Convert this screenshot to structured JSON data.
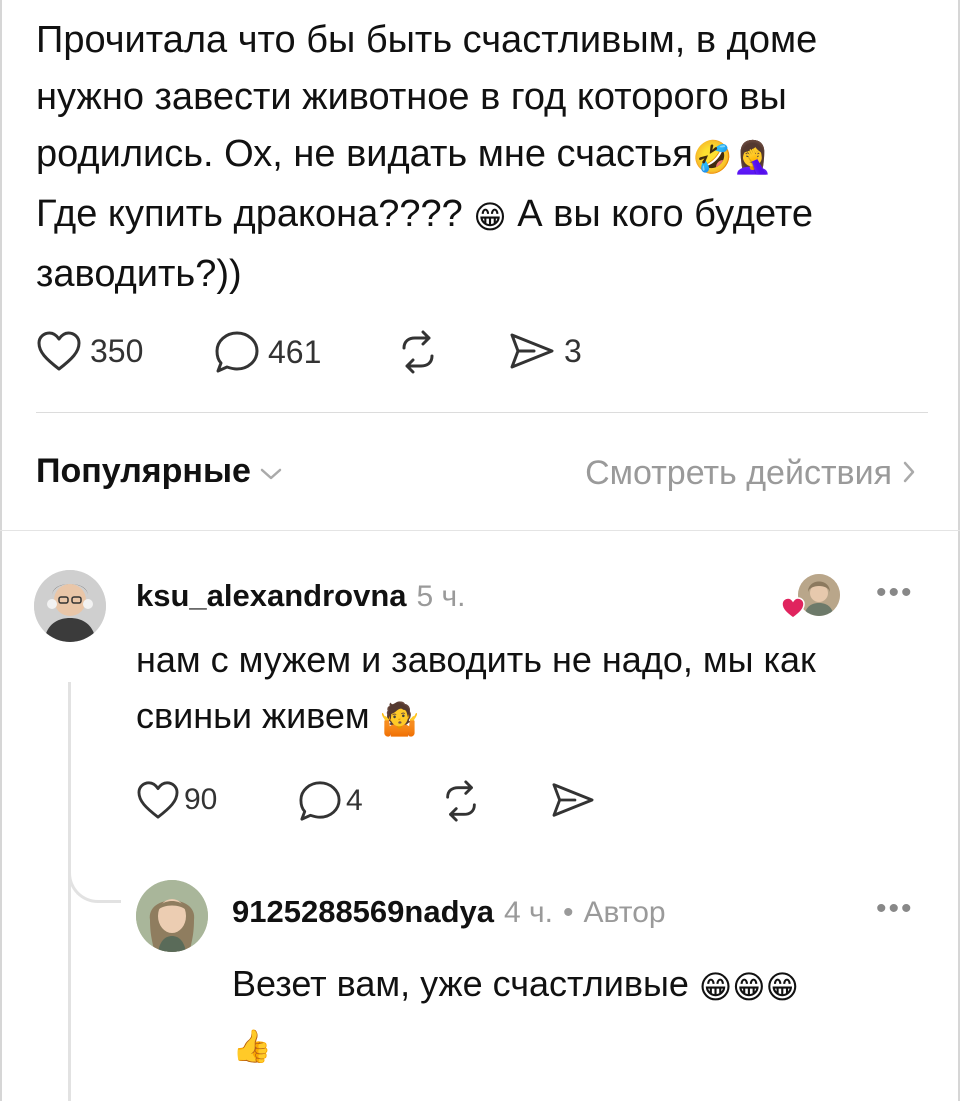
{
  "post": {
    "text_lines": [
      "Прочитала что бы быть счастливым, в доме",
      "нужно завести животное в год которого вы",
      "родились. Ох, не видать мне счастья",
      "Где купить дракона????",
      "заводить?))"
    ],
    "line3_emojis": "🤣🤦‍♀️",
    "line4_emoji": "😁",
    "line4_tail": " А вы кого будете",
    "likes": "350",
    "comments": "461",
    "shares": "3"
  },
  "sort": {
    "label": "Популярные",
    "view_actions": "Смотреть действия"
  },
  "comments": [
    {
      "username": "ksu_alexandrovna",
      "time": "5 ч.",
      "text_lines": [
        "нам с мужем и заводить не надо, мы как",
        "свиньи живем"
      ],
      "text_emoji": "🤷",
      "likes": "90",
      "replies": "4",
      "replies_list": [
        {
          "username": "9125288569nadya",
          "time": "4 ч.",
          "separator": "•",
          "badge": "Автор",
          "text": "Везет вам, уже счастливые",
          "emojis": "😁😁😁",
          "line2_emoji": "👍"
        }
      ]
    }
  ],
  "icons": [
    "heart-icon",
    "comment-icon",
    "repost-icon",
    "share-icon",
    "chevron-down-icon",
    "chevron-right-icon",
    "more-icon"
  ],
  "colors": {
    "text": "#111111",
    "muted": "#9a9a9a",
    "divider": "#dcdcdc",
    "like_heart": "#e0245e"
  }
}
